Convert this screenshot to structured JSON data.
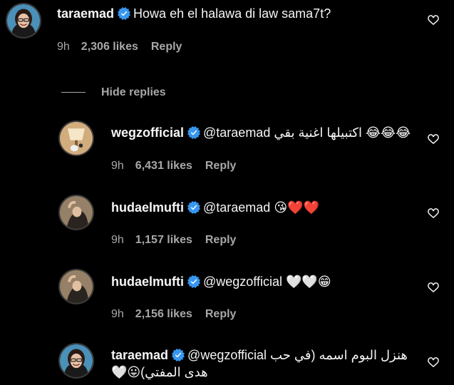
{
  "comments": [
    {
      "username": "taraemad",
      "text": "Howa eh el halawa di law sama7t?",
      "time": "9h",
      "likes": "2,306 likes",
      "reply_label": "Reply"
    }
  ],
  "hide_replies_label": "Hide replies",
  "replies": [
    {
      "username": "wegzofficial",
      "text": "@taraemad اكتبيلها اغنية بقي 😂😂😂",
      "time": "9h",
      "likes": "6,431 likes",
      "reply_label": "Reply"
    },
    {
      "username": "hudaelmufti",
      "text": "@taraemad 😘❤️❤️",
      "time": "9h",
      "likes": "1,157 likes",
      "reply_label": "Reply"
    },
    {
      "username": "hudaelmufti",
      "text": "@wegzofficial 🤍🤍😁",
      "time": "9h",
      "likes": "2,156 likes",
      "reply_label": "Reply"
    },
    {
      "username": "taraemad",
      "text_line1": "@wegzofficial هنزل البوم اسمه (في حب",
      "text_line2": "هدى المفتي)😛🤍"
    }
  ],
  "colors": {
    "background": "#000000",
    "text": "#f5f5f5",
    "secondary": "#a8a8a8",
    "verified": "#3897f0"
  },
  "icons": {
    "verified": "verified-badge-icon",
    "like": "heart-outline-icon"
  }
}
